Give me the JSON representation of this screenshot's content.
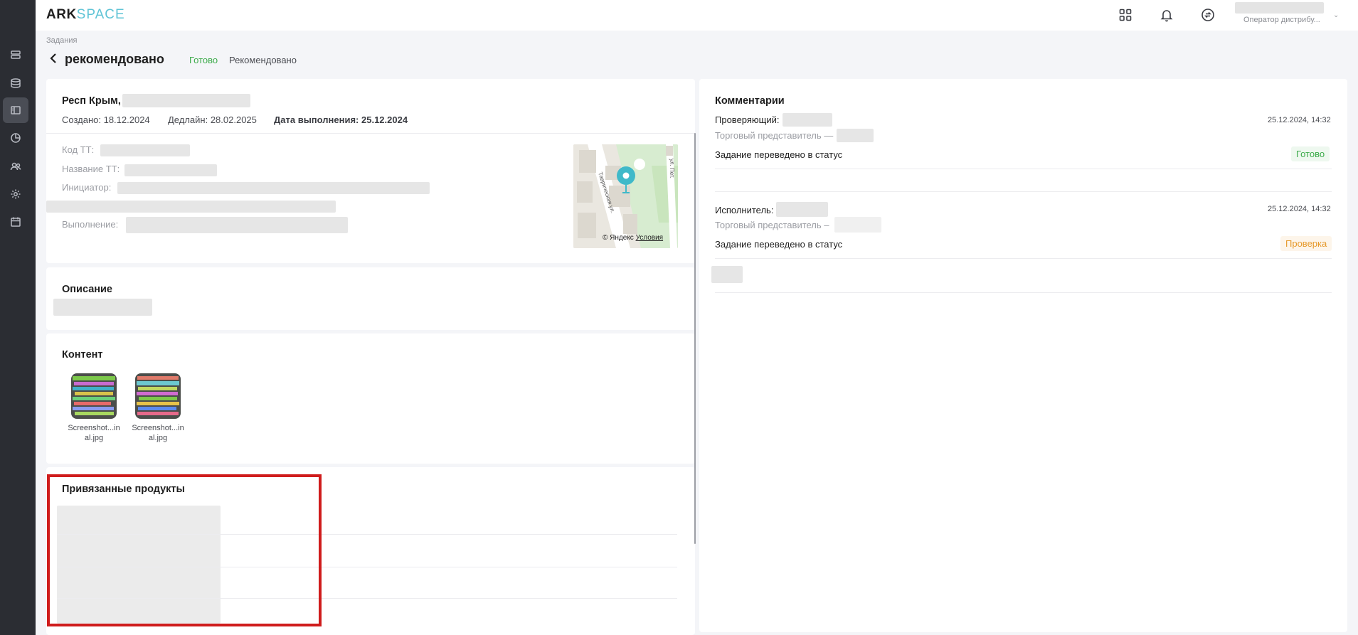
{
  "app": {
    "logo_part1": "ARK",
    "logo_part2": "SPACE",
    "user_role": "Оператор дистрибу..."
  },
  "nav_icons": [
    "list-icon",
    "database-icon",
    "tasks-icon",
    "chart-icon",
    "users-icon",
    "settings-icon",
    "calendar-icon"
  ],
  "top_icons": [
    "apps-grid-icon",
    "bell-icon",
    "sync-icon"
  ],
  "header": {
    "breadcrumb": "Задания",
    "title": "рекомендовано",
    "status_current": "Готово",
    "status_recommended": "Рекомендовано"
  },
  "task": {
    "address": "Респ Крым,",
    "created": "Создано: 18.12.2024",
    "deadline": "Дедлайн: 28.02.2025",
    "done_label": "Дата выполнения:",
    "done_value": "25.12.2024",
    "field_code": "Код ТТ:",
    "field_name": "Название ТТ:",
    "field_initiator": "Инициатор:",
    "field_execution": "Выполнение:"
  },
  "map": {
    "copyright": "© Яндекс",
    "terms": "Условия"
  },
  "description": {
    "title": "Описание"
  },
  "content": {
    "title": "Контент",
    "files": [
      {
        "line1": "Screenshot...in",
        "line2": "al.jpg"
      },
      {
        "line1": "Screenshot...in",
        "line2": "al.jpg"
      }
    ]
  },
  "products": {
    "title": "Привязанные продукты"
  },
  "comments": {
    "title": "Комментарии",
    "items": [
      {
        "role": "Проверяющий:",
        "sub": "Торговый представитель —",
        "time": "25.12.2024, 14:32",
        "text": "Задание переведено в статус",
        "status": "Готово",
        "status_color": "#3cab4a"
      },
      {
        "role": "Исполнитель:",
        "sub": "Торговый представитель –",
        "time": "25.12.2024, 14:32",
        "text": "Задание переведено в статус",
        "status": "Проверка",
        "status_color": "#e69a2c"
      }
    ]
  }
}
